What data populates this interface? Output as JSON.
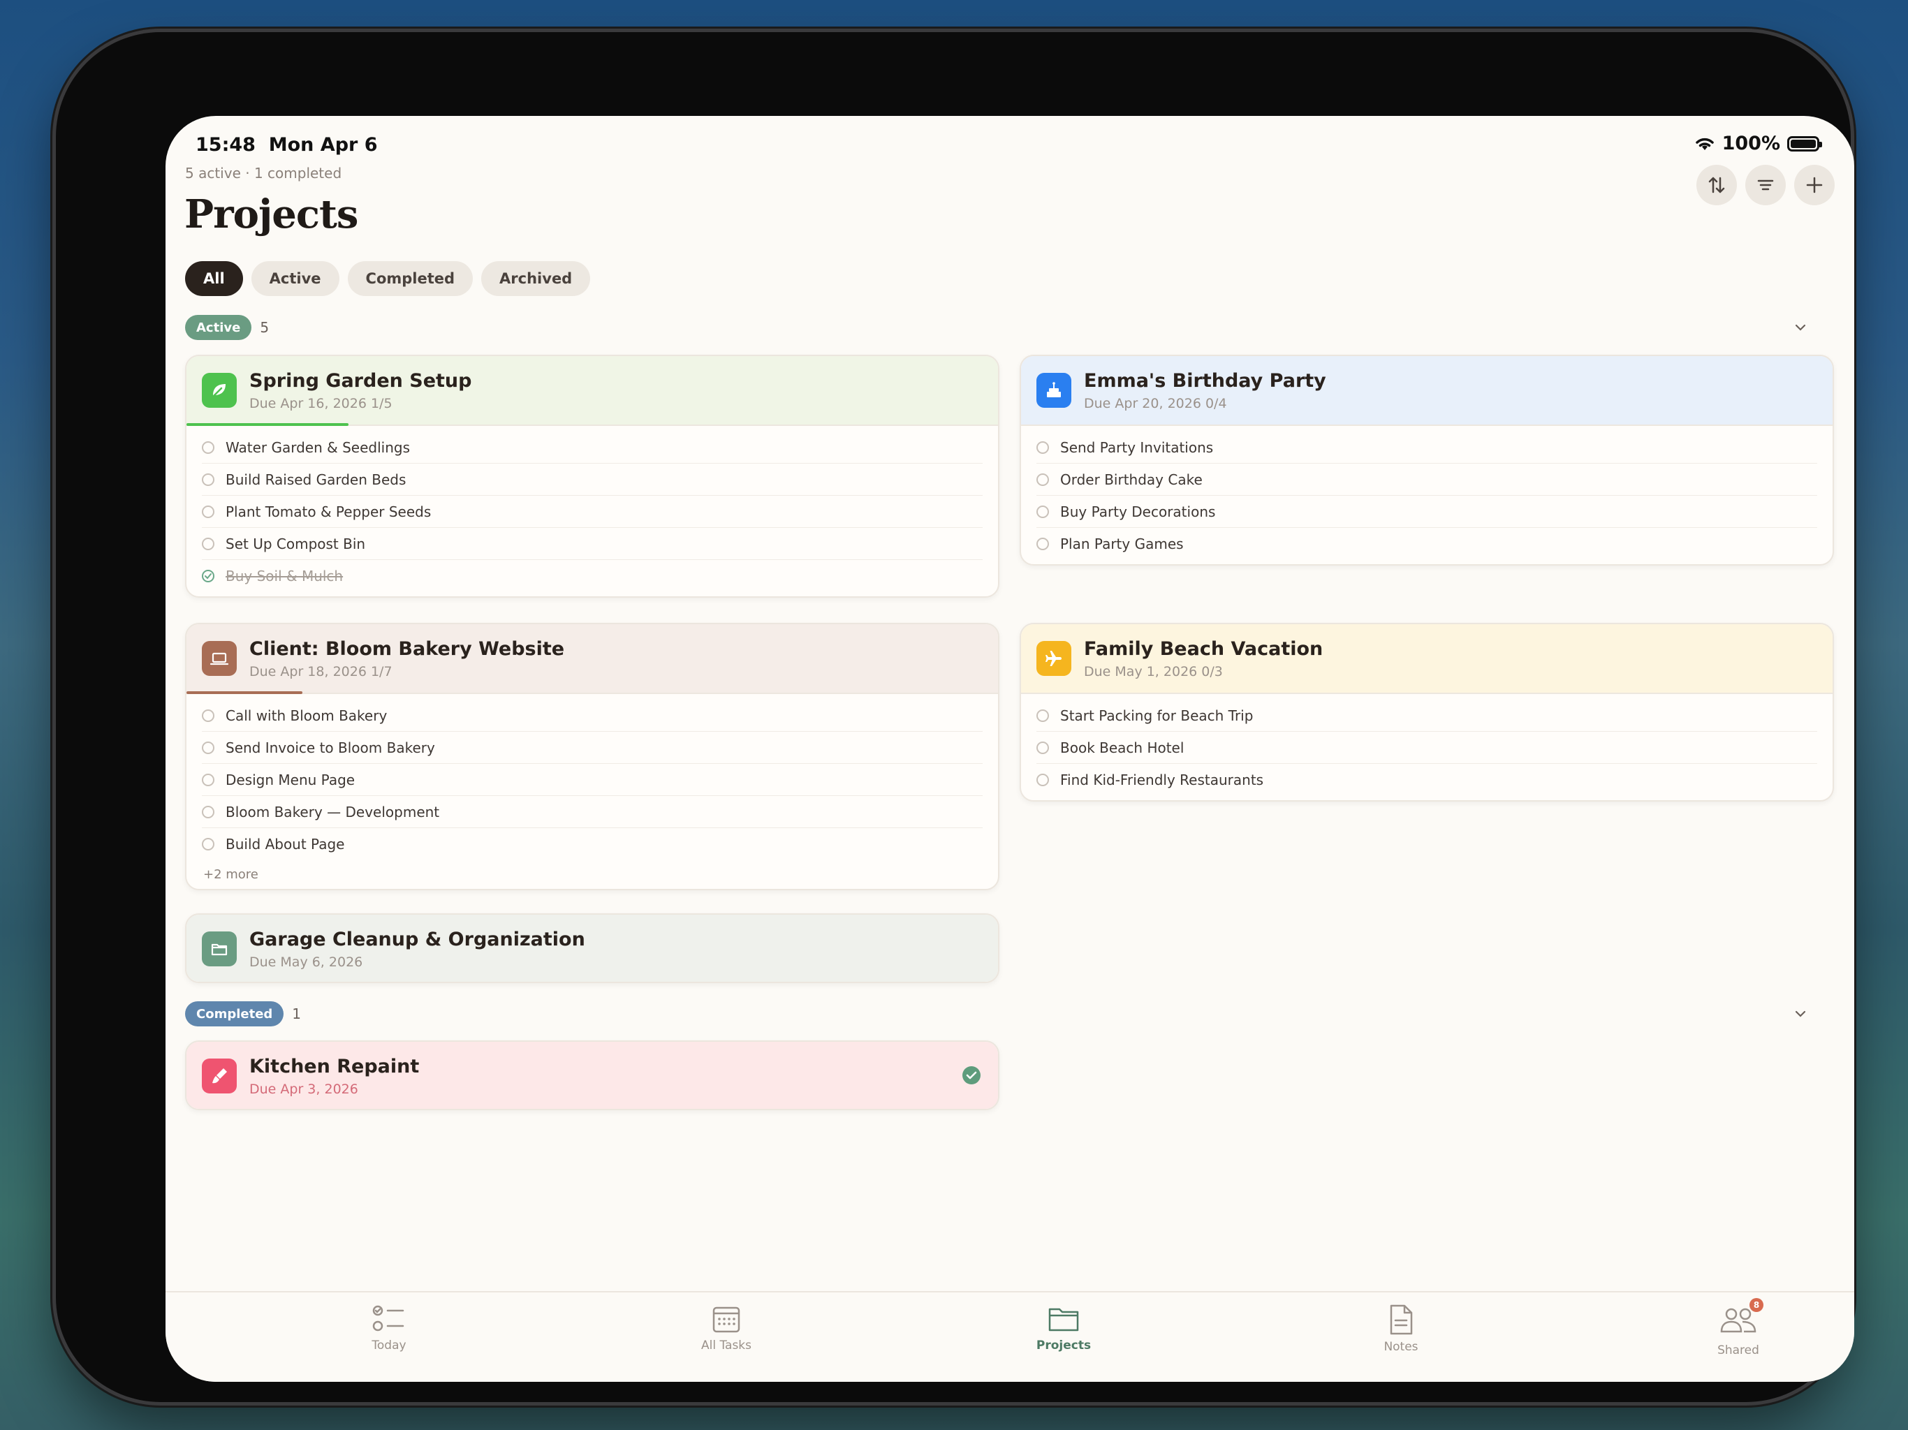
{
  "status": {
    "time": "15:48",
    "date": "Mon Apr 6",
    "battery": "100%"
  },
  "header": {
    "summary": "5 active · 1 completed",
    "title": "Projects"
  },
  "filters": [
    {
      "label": "All",
      "active": true
    },
    {
      "label": "Active",
      "active": false
    },
    {
      "label": "Completed",
      "active": false
    },
    {
      "label": "Archived",
      "active": false
    }
  ],
  "sections": {
    "active": {
      "label": "Active",
      "count": "5",
      "color": "#6a9c82"
    },
    "completed": {
      "label": "Completed",
      "count": "1",
      "color": "#5f86ad"
    }
  },
  "projects": {
    "spring": {
      "title": "Spring Garden Setup",
      "sub": "Due Apr 16, 2026  1/5",
      "progress": 0.2,
      "icon": "leaf-icon",
      "accent": "#4ec24e",
      "head_bg": "#f0f5e6",
      "tasks": [
        {
          "label": "Water Garden & Seedlings",
          "done": false
        },
        {
          "label": "Build Raised Garden Beds",
          "done": false
        },
        {
          "label": "Plant Tomato & Pepper Seeds",
          "done": false
        },
        {
          "label": "Set Up Compost Bin",
          "done": false
        },
        {
          "label": "Buy Soil & Mulch",
          "done": true
        }
      ]
    },
    "emma": {
      "title": "Emma's Birthday Party",
      "sub": "Due Apr 20, 2026  0/4",
      "progress": 0,
      "icon": "cake-icon",
      "accent": "#2a7ff0",
      "head_bg": "#e8f0fa",
      "tasks": [
        {
          "label": "Send Party Invitations",
          "done": false
        },
        {
          "label": "Order Birthday Cake",
          "done": false
        },
        {
          "label": "Buy Party Decorations",
          "done": false
        },
        {
          "label": "Plan Party Games",
          "done": false
        }
      ]
    },
    "bloom": {
      "title": "Client: Bloom Bakery Website",
      "sub": "Due Apr 18, 2026  1/7",
      "progress": 0.143,
      "icon": "laptop-icon",
      "accent": "#a86d55",
      "head_bg": "#f5ede8",
      "tasks": [
        {
          "label": "Call with Bloom Bakery",
          "done": false
        },
        {
          "label": "Send Invoice to Bloom Bakery",
          "done": false
        },
        {
          "label": "Design Menu Page",
          "done": false
        },
        {
          "label": "Bloom Bakery — Development",
          "done": false
        },
        {
          "label": "Build About Page",
          "done": false
        }
      ],
      "more": "+2 more"
    },
    "beach": {
      "title": "Family Beach Vacation",
      "sub": "Due May 1, 2026  0/3",
      "progress": 0,
      "icon": "airplane-icon",
      "accent": "#f5b51f",
      "head_bg": "#fdf5df",
      "tasks": [
        {
          "label": "Start Packing for Beach Trip",
          "done": false
        },
        {
          "label": "Book Beach Hotel",
          "done": false
        },
        {
          "label": "Find Kid-Friendly Restaurants",
          "done": false
        }
      ]
    },
    "garage": {
      "title": "Garage Cleanup & Organization",
      "sub": "Due May 6, 2026",
      "icon": "folder-icon",
      "accent": "#6a9c82",
      "head_bg": "#eff1ec"
    },
    "kitchen": {
      "title": "Kitchen Repaint",
      "sub": "Due Apr 3, 2026",
      "icon": "paintbrush-icon",
      "accent": "#ef5470",
      "head_bg": "#fde8e8"
    }
  },
  "tabs": [
    {
      "label": "Today",
      "icon": "checklist-icon"
    },
    {
      "label": "All Tasks",
      "icon": "calendar-icon"
    },
    {
      "label": "Projects",
      "icon": "folder-icon",
      "active": true
    },
    {
      "label": "Notes",
      "icon": "document-icon"
    },
    {
      "label": "Shared",
      "icon": "people-icon",
      "badge": "8"
    }
  ]
}
